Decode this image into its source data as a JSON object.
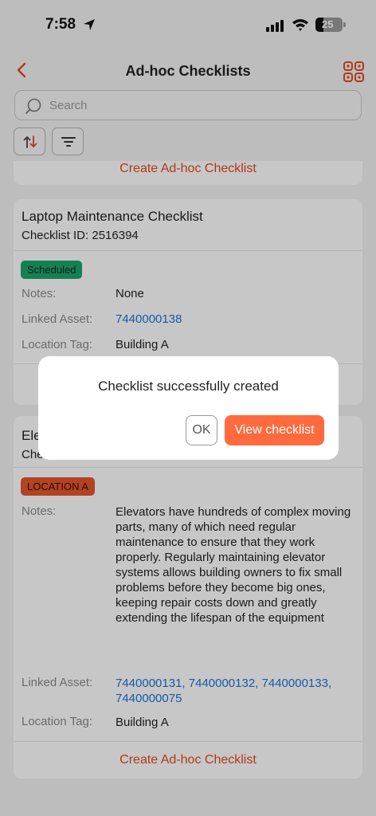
{
  "status_bar": {
    "time": "7:58",
    "battery": "25"
  },
  "nav": {
    "title": "Ad-hoc Checklists"
  },
  "search": {
    "placeholder": "Search"
  },
  "top_card": {
    "create_label": "Create Ad-hoc Checklist"
  },
  "cards": [
    {
      "title": "Laptop Maintenance Checklist",
      "checklist_id": "Checklist ID: 2516394",
      "badge": "Scheduled",
      "notes_label": "Notes:",
      "notes": "None",
      "linked_asset_label": "Linked Asset:",
      "linked_asset": "7440000138",
      "location_label": "Location Tag:",
      "location": "Building A"
    },
    {
      "title_partial": "Ele",
      "id_partial": "Che",
      "badge": "LOCATION A",
      "notes_label": "Notes:",
      "notes": "Elevators have hundreds of complex moving parts, many of which need regular maintenance to ensure that they work properly. Regularly maintaining elevator systems allows building owners to fix small problems before they become big ones, keeping repair costs down and greatly extending the lifespan of the equipment",
      "linked_asset_label": "Linked Asset:",
      "linked_asset": "7440000131, 7440000132, 7440000133, 7440000075",
      "location_label": "Location Tag:",
      "location": "Building A",
      "create_label": "Create Ad-hoc Checklist"
    }
  ],
  "dialog": {
    "message": "Checklist successfully created",
    "ok_label": "OK",
    "view_label": "View checklist"
  },
  "colors": {
    "accent": "#ff6b3e",
    "link": "#1a73d9",
    "scheduled": "#1ca46c",
    "location_badge": "#e4562e"
  },
  "icons": [
    "location-arrow-icon",
    "signal-icon",
    "wifi-icon",
    "battery-icon",
    "back-chevron-icon",
    "qr-scan-icon",
    "search-icon",
    "sort-icon",
    "filter-icon"
  ]
}
